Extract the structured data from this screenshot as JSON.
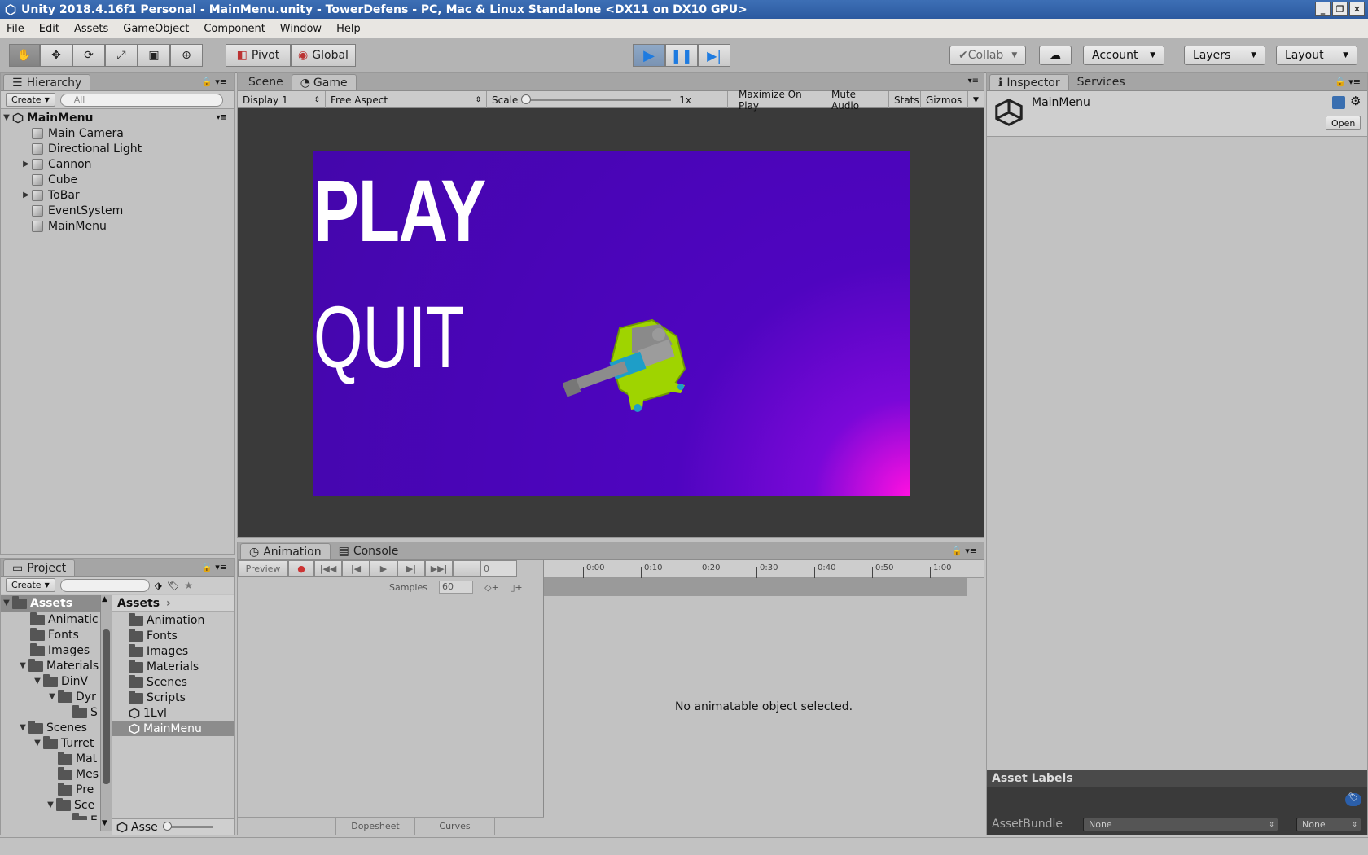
{
  "window": {
    "title": "Unity 2018.4.16f1 Personal - MainMenu.unity - TowerDefens - PC, Mac & Linux Standalone <DX11 on DX10 GPU>",
    "minimize": "_",
    "maximize": "❐",
    "close": "✕"
  },
  "menu": [
    "File",
    "Edit",
    "Assets",
    "GameObject",
    "Component",
    "Window",
    "Help"
  ],
  "toolbar": {
    "pivot": "Pivot",
    "global": "Global",
    "collab": "Collab",
    "account": "Account",
    "layers": "Layers",
    "layout": "Layout"
  },
  "hierarchy": {
    "tab": "Hierarchy",
    "create": "Create",
    "search_placeholder": "All",
    "scene": "MainMenu",
    "items": [
      "Main Camera",
      "Directional Light",
      "Cannon",
      "Cube",
      "ToBar",
      "EventSystem",
      "MainMenu"
    ]
  },
  "scene_view": {
    "tab_scene": "Scene",
    "tab_game": "Game",
    "display": "Display 1",
    "aspect": "Free Aspect",
    "scale_label": "Scale",
    "scale_value": "1x",
    "maximize": "Maximize On Play",
    "mute": "Mute Audio",
    "stats": "Stats",
    "gizmos": "Gizmos"
  },
  "game": {
    "play": "PLAY",
    "quit": "QUIT"
  },
  "inspector": {
    "tab": "Inspector",
    "services": "Services",
    "object": "MainMenu",
    "open": "Open",
    "asset_labels": "Asset Labels",
    "assetbundle": "AssetBundle",
    "bundle_value": "None",
    "variant_value": "None"
  },
  "project": {
    "tab": "Project",
    "create": "Create",
    "tree": [
      {
        "label": "Assets",
        "indent": 0,
        "tri": "▼"
      },
      {
        "label": "Animatic",
        "indent": 1,
        "tri": ""
      },
      {
        "label": "Fonts",
        "indent": 1,
        "tri": ""
      },
      {
        "label": "Images",
        "indent": 1,
        "tri": ""
      },
      {
        "label": "Materials",
        "indent": 1,
        "tri": "▼"
      },
      {
        "label": "DinV",
        "indent": 2,
        "tri": "▼"
      },
      {
        "label": "Dyr",
        "indent": 3,
        "tri": "▼"
      },
      {
        "label": "S",
        "indent": 4,
        "tri": ""
      },
      {
        "label": "Scenes",
        "indent": 1,
        "tri": "▼"
      },
      {
        "label": "Turret",
        "indent": 2,
        "tri": "▼"
      },
      {
        "label": "Mat",
        "indent": 3,
        "tri": ""
      },
      {
        "label": "Mes",
        "indent": 3,
        "tri": ""
      },
      {
        "label": "Pre",
        "indent": 3,
        "tri": ""
      },
      {
        "label": "Sce",
        "indent": 3,
        "tri": "▼"
      },
      {
        "label": "E",
        "indent": 4,
        "tri": ""
      }
    ],
    "breadcrumb": "Assets",
    "files": [
      {
        "label": "Animation",
        "type": "folder"
      },
      {
        "label": "Fonts",
        "type": "folder"
      },
      {
        "label": "Images",
        "type": "folder"
      },
      {
        "label": "Materials",
        "type": "folder"
      },
      {
        "label": "Scenes",
        "type": "folder"
      },
      {
        "label": "Scripts",
        "type": "folder"
      },
      {
        "label": "1Lvl",
        "type": "scene"
      },
      {
        "label": "MainMenu",
        "type": "scene"
      }
    ],
    "footer": "Asse"
  },
  "animation": {
    "tab": "Animation",
    "console": "Console",
    "preview": "Preview",
    "frame": "0",
    "samples_label": "Samples",
    "samples": "60",
    "ticks": [
      "0:00",
      "0:10",
      "0:20",
      "0:30",
      "0:40",
      "0:50",
      "1:00"
    ],
    "empty": "No animatable object selected.",
    "dopesheet": "Dopesheet",
    "curves": "Curves"
  },
  "colors": {
    "accent": "#3d87d8",
    "game_bg": "#4a05b8",
    "game_corner": "#ff10e0"
  }
}
